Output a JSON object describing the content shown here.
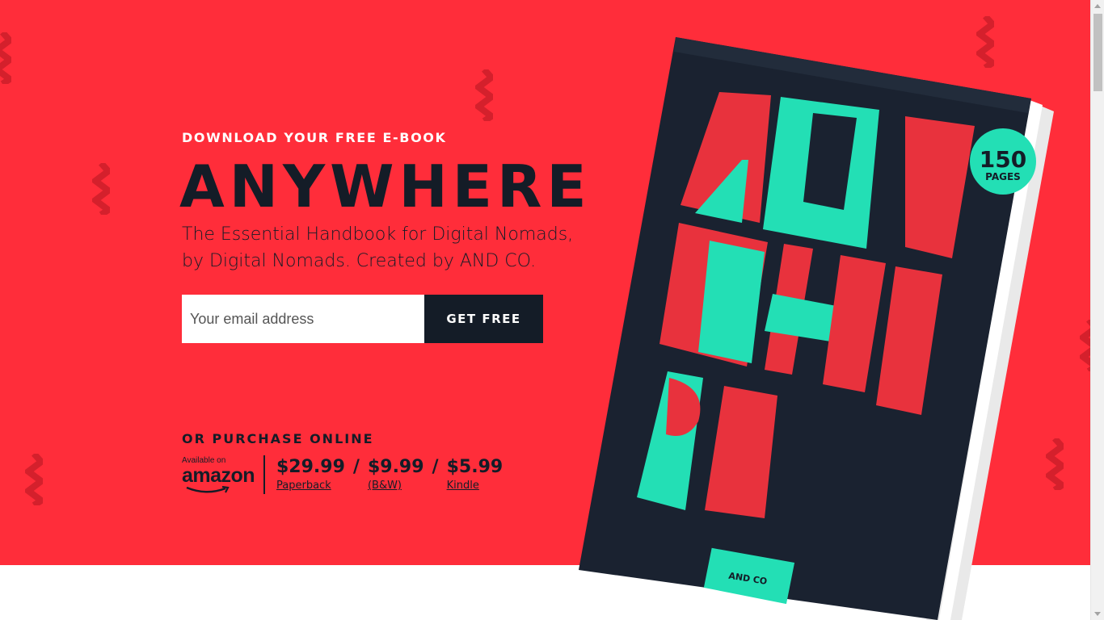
{
  "hero": {
    "eyebrow": "DOWNLOAD YOUR FREE E-BOOK",
    "title": "ANYWHERE",
    "subtitle": "The Essential Handbook for Digital Nomads, by Digital Nomads. Created by AND CO.",
    "email_placeholder": "Your email address",
    "cta_label": "GET FREE",
    "background_color": "#ff2d3a",
    "dark_color": "#141c27"
  },
  "purchase": {
    "heading": "OR PURCHASE ONLINE",
    "amazon_small": "Available on",
    "amazon_word": "amazon",
    "options": [
      {
        "price": "$29.99",
        "format": "Paperback"
      },
      {
        "price": "$9.99",
        "format": "(B&W)"
      },
      {
        "price": "$5.99",
        "format": "Kindle"
      }
    ],
    "separator": "/"
  },
  "book": {
    "badge_number": "150",
    "badge_label": "PAGES",
    "publisher": "AND CO",
    "accent_teal": "#23dfb5"
  }
}
